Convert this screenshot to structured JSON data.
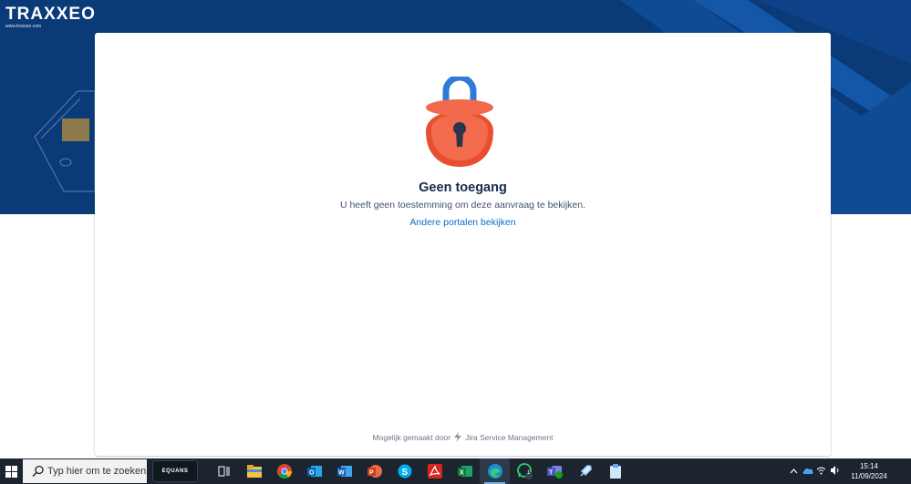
{
  "app": {
    "logo_text": "TRAXXEO",
    "logo_url": "www.traxxeo.com"
  },
  "error_page": {
    "title": "Geen toegang",
    "message": "U heeft geen toestemming om deze aanvraag te bekijken.",
    "link_label": "Andere portalen bekijken"
  },
  "footer": {
    "powered_by": "Mogelijk gemaakt door",
    "product": "Jira Service Management"
  },
  "taskbar": {
    "search_placeholder": "Typ hier om te zoeken",
    "pinned_app_label": "EQUANS",
    "apps": [
      "task-view",
      "file-explorer",
      "chrome",
      "outlook",
      "word",
      "powerpoint",
      "skype",
      "acrobat",
      "excel",
      "edge",
      "whatsapp",
      "teams",
      "rocket-app",
      "clipboard-app"
    ],
    "active_app": "edge",
    "whatsapp_badge": "1",
    "time": "15:14",
    "date": "11/09/2024"
  },
  "colors": {
    "hero_bg": "#0b3a78",
    "lock_body": "#f0573a",
    "lock_shackle": "#2f7bd8",
    "link": "#0b6dc7",
    "taskbar_bg": "#1c2430"
  }
}
